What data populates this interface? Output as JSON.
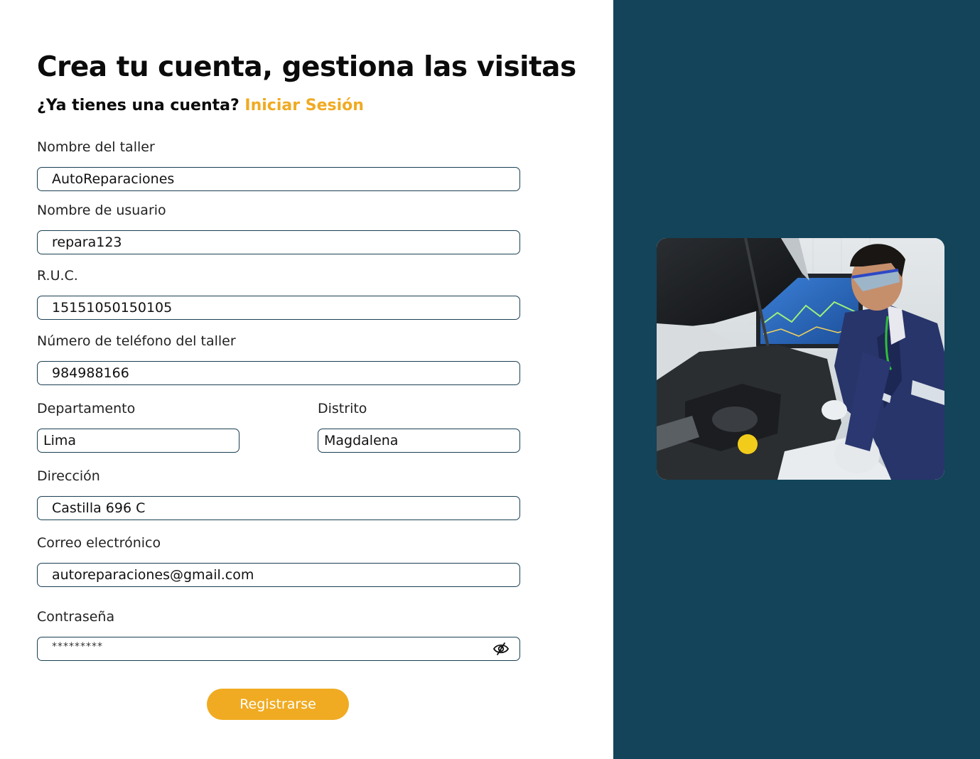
{
  "header": {
    "title": "Crea tu cuenta, gestiona las visitas",
    "login_prompt": "¿Ya tienes una cuenta?",
    "login_link": "Iniciar Sesión"
  },
  "form": {
    "taller": {
      "label": "Nombre del taller",
      "value": "AutoReparaciones"
    },
    "usuario": {
      "label": "Nombre de usuario",
      "value": "repara123"
    },
    "ruc": {
      "label": "R.U.C.",
      "value": "15151050150105"
    },
    "telefono": {
      "label": "Número de teléfono del taller",
      "value": "984988166"
    },
    "departamento": {
      "label": "Departamento",
      "value": "Lima"
    },
    "distrito": {
      "label": "Distrito",
      "value": "Magdalena"
    },
    "direccion": {
      "label": "Dirección",
      "value": "Castilla 696 C"
    },
    "correo": {
      "label": "Correo electrónico",
      "value": "autoreparaciones@gmail.com"
    },
    "contrasena": {
      "label": "Contraseña",
      "value": "*********",
      "toggle_icon": "eye-slash-icon"
    },
    "submit_label": "Registrarse"
  },
  "colors": {
    "accent": "#f0aa22",
    "panel": "#134459",
    "field_border": "#1a3f53"
  },
  "image": {
    "subject": "mechanic-photo"
  }
}
